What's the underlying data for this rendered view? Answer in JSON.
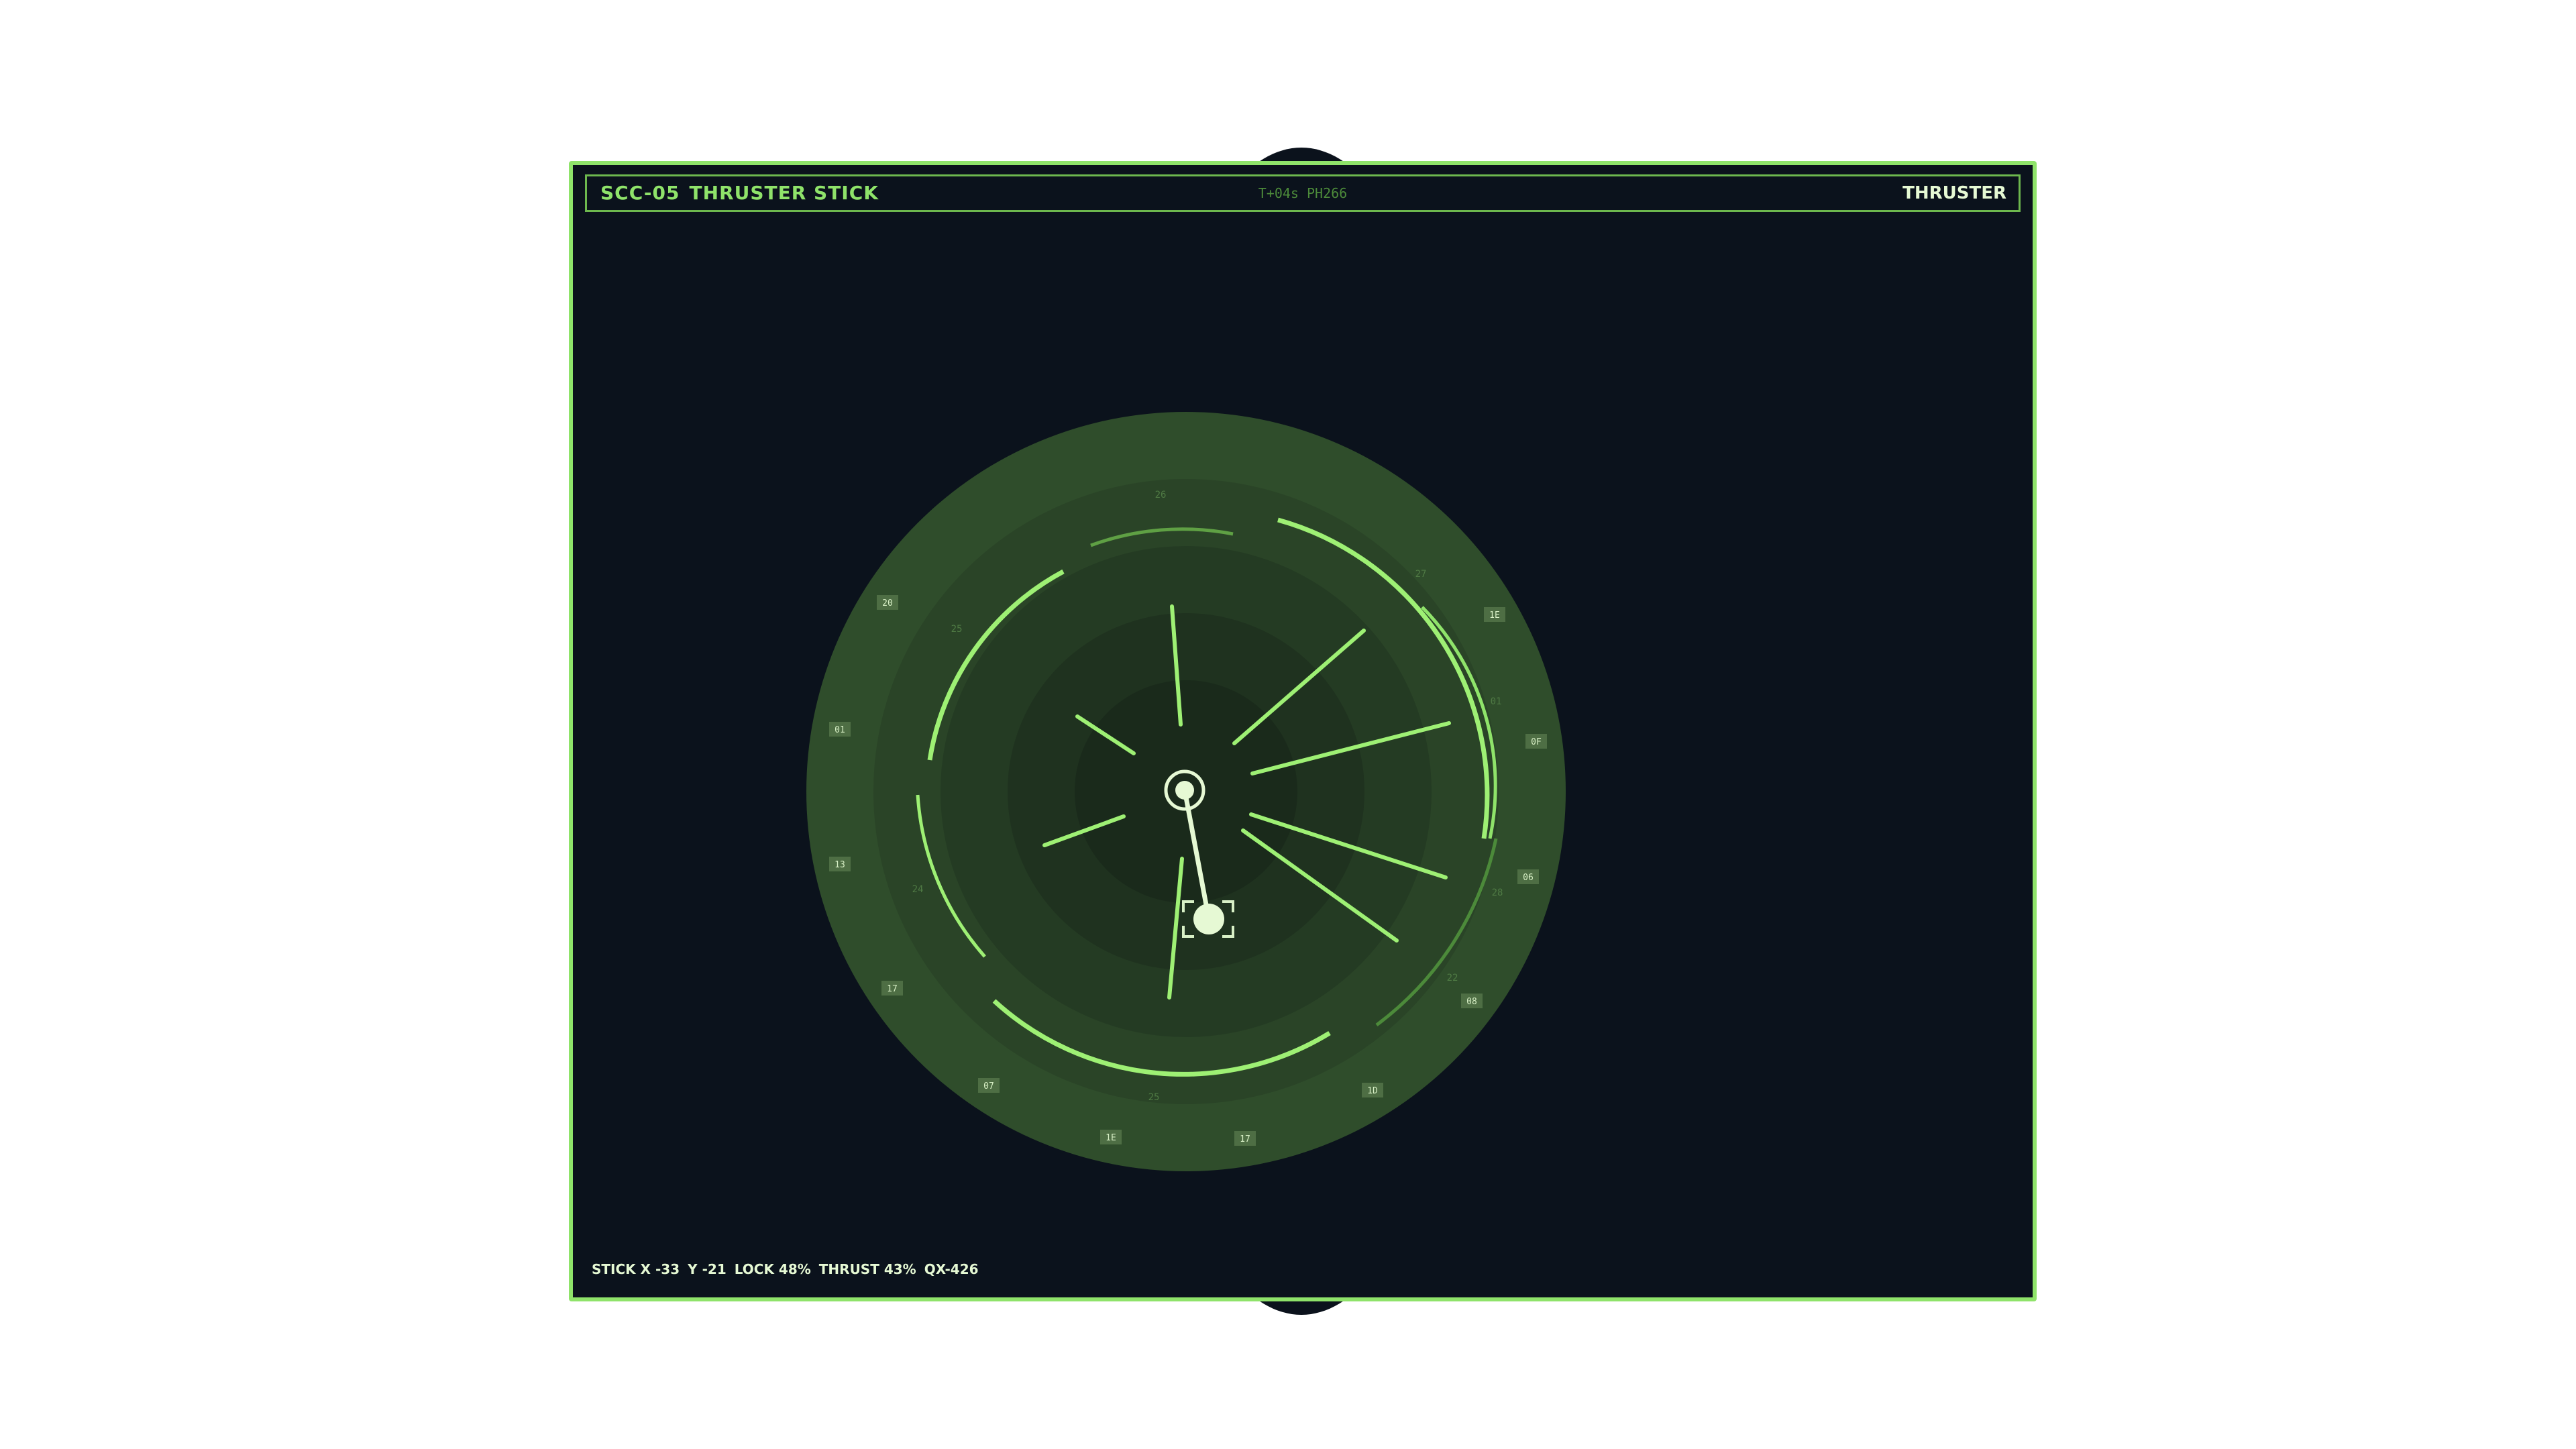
{
  "window": {
    "code": "SCC-05",
    "title": "THRUSTER STICK",
    "telemetry": "T+04s PH266",
    "mode": "THRUSTER"
  },
  "status": {
    "stick_x": "STICK X -33",
    "stick_y": "Y -21",
    "lock": "LOCK 48%",
    "thrust": "THRUST 43%",
    "qx": "QX-426"
  },
  "dial": {
    "outer_tags": [
      "20",
      "1E",
      "01",
      "0F",
      "13",
      "06",
      "17",
      "08",
      "07",
      "1D",
      "1E",
      "17"
    ],
    "inner_ticks": [
      "26",
      "27",
      "25",
      "01",
      "24",
      "28",
      "22",
      "25"
    ]
  },
  "colors": {
    "accent": "#8fe36a",
    "panel_bg": "#0b121c",
    "ring_outer": "#2f4d2b",
    "knob": "#e6f9d4"
  }
}
